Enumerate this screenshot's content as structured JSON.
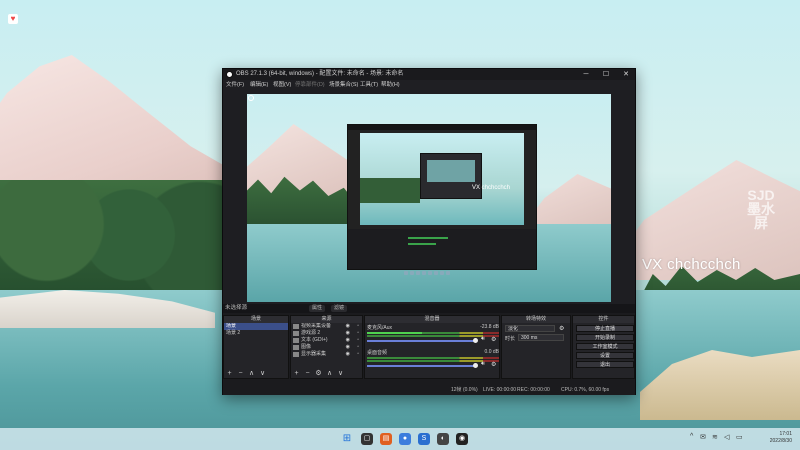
{
  "desktop": {
    "watermark": "VX chchcchch",
    "logo": "SJD 墨水屏",
    "corner_icon": "heart-icon"
  },
  "obs": {
    "title": "OBS 27.1.3 (64-bit, windows) - 配置文件: 未命名 - 场景: 未命名",
    "menu": [
      "文件(F)",
      "编辑(E)",
      "视图(V)",
      "停靠部件(D)",
      "场景集合(S)",
      "工具(T)",
      "帮助(H)"
    ],
    "nested_watermark": "VX chchcchch",
    "scene_label": "未选择源",
    "toolbar_buttons": [
      "属性",
      "滤镜"
    ],
    "docks": {
      "scenes": {
        "title": "场景",
        "items": [
          "场景",
          "场景 2"
        ],
        "selected": 0
      },
      "sources": {
        "title": "来源",
        "items": [
          "视频采集设备",
          "游戏源 2",
          "文本 (GDI+)",
          "图像",
          "显示器采集"
        ]
      },
      "mixer": {
        "title": "混音器",
        "channels": [
          {
            "name": "麦克风/Aux",
            "db": "-23.8 dB",
            "level": 0.42
          },
          {
            "name": "桌面音频",
            "db": "0.0 dB",
            "level": 0.0
          }
        ]
      },
      "transitions": {
        "title": "转场特效",
        "type": "淡化",
        "duration_label": "时长",
        "duration": "300 ms"
      },
      "controls": {
        "title": "控件",
        "buttons": [
          "停止直播",
          "开始录制",
          "工作室模式",
          "设置",
          "退出"
        ]
      }
    },
    "status": {
      "live": "LIVE: 00:00:00",
      "rec": "REC: 00:00:00",
      "dropped": "12帧 (0.0%)",
      "cpu": "CPU: 0.7%, 60.00 fps"
    }
  },
  "taskbar": {
    "apps": [
      "start",
      "search",
      "explorer",
      "obs",
      "browser",
      "store",
      "vscode",
      "edge",
      "obs-studio"
    ],
    "time": "17:01",
    "date": "2022/8/30"
  }
}
